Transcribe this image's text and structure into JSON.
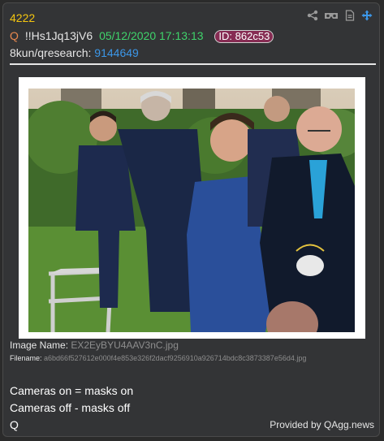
{
  "post": {
    "number": "4222",
    "author": "Q",
    "tripcode": "!!Hs1Jq13jV6",
    "datetime": "05/12/2020 17:13:13",
    "id_label": "ID: 862c53",
    "board": "8kun/qresearch:",
    "post_link": "9144649"
  },
  "toolbar_icons": [
    "share-icon",
    "vr-glasses-icon",
    "document-icon",
    "move-arrows-icon"
  ],
  "image": {
    "name_label": "Image Name:",
    "name_value": "EX2EyBYU4AAV3nC.jpg",
    "filename_label": "Filename:",
    "filename_value": "a6bd66f527612e000f4e853e326f2dacf9256910a926714bdc8c3873387e56d4.jpg"
  },
  "message": {
    "line1": "Cameras on = masks on",
    "line2": "Cameras off - masks off",
    "line3": "Q"
  },
  "footer": {
    "provided": "Provided by QAgg.news"
  },
  "colors": {
    "background": "#333436",
    "post_number": "#f5c60f",
    "author_q": "#e8884f",
    "date": "#3fd36b",
    "id_badge": "#862c53",
    "link": "#3c97e8",
    "toolbar_icon": "#9a9a9a",
    "move_icon": "#3c97e8"
  }
}
